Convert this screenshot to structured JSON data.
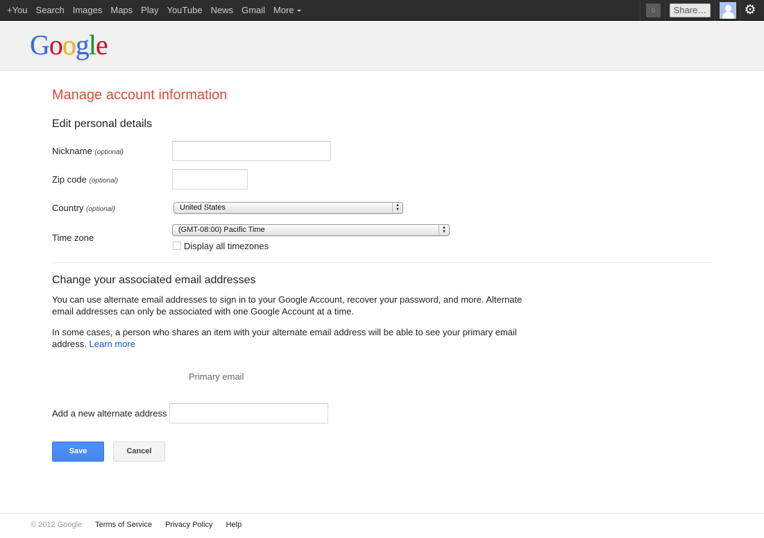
{
  "topbar": {
    "nav": [
      {
        "label": "+You"
      },
      {
        "label": "Search"
      },
      {
        "label": "Images"
      },
      {
        "label": "Maps"
      },
      {
        "label": "Play"
      },
      {
        "label": "YouTube"
      },
      {
        "label": "News"
      },
      {
        "label": "Gmail"
      },
      {
        "label": "More"
      }
    ],
    "notification_count": "0",
    "share_label": "Share…",
    "icons": {
      "avatar": "user-avatar-icon",
      "settings": "gear-icon"
    }
  },
  "header": {
    "logo": [
      {
        "ch": "G",
        "color": "#3369e8"
      },
      {
        "ch": "o",
        "color": "#d50f25"
      },
      {
        "ch": "o",
        "color": "#eeb211"
      },
      {
        "ch": "g",
        "color": "#3369e8"
      },
      {
        "ch": "l",
        "color": "#009925"
      },
      {
        "ch": "e",
        "color": "#d50f25"
      }
    ]
  },
  "main": {
    "title": "Manage account information",
    "personal": {
      "heading": "Edit personal details",
      "nickname": {
        "label": "Nickname",
        "hint": "(optional)",
        "value": ""
      },
      "zip": {
        "label": "Zip code",
        "hint": "(optional)",
        "value": ""
      },
      "country": {
        "label": "Country",
        "hint": "(optional)",
        "selected": "United States"
      },
      "timezone": {
        "label": "Time zone",
        "selected": "(GMT-08:00) Pacific Time"
      },
      "display_all_timezones": {
        "label": "Display all timezones",
        "checked": false
      }
    },
    "email": {
      "heading": "Change your associated email addresses",
      "para1": "You can use alternate email addresses to sign in to your Google Account, recover your password, and more. Alternate email addresses can only be associated with one Google Account at a time.",
      "para2": "In some cases, a person who shares an item with your alternate email address will be able to see your primary email address.",
      "learn_more": "Learn more",
      "primary_label": "Primary email",
      "add_label": "Add a new alternate address",
      "add_value": ""
    },
    "buttons": {
      "save": "Save",
      "cancel": "Cancel"
    }
  },
  "footer": {
    "copyright": "© 2012 Google",
    "links": [
      "Terms of Service",
      "Privacy Policy",
      "Help"
    ]
  },
  "colors": {
    "title": "#dd4b39",
    "link": "#1155cc",
    "primary_button": "#4d90fe"
  }
}
